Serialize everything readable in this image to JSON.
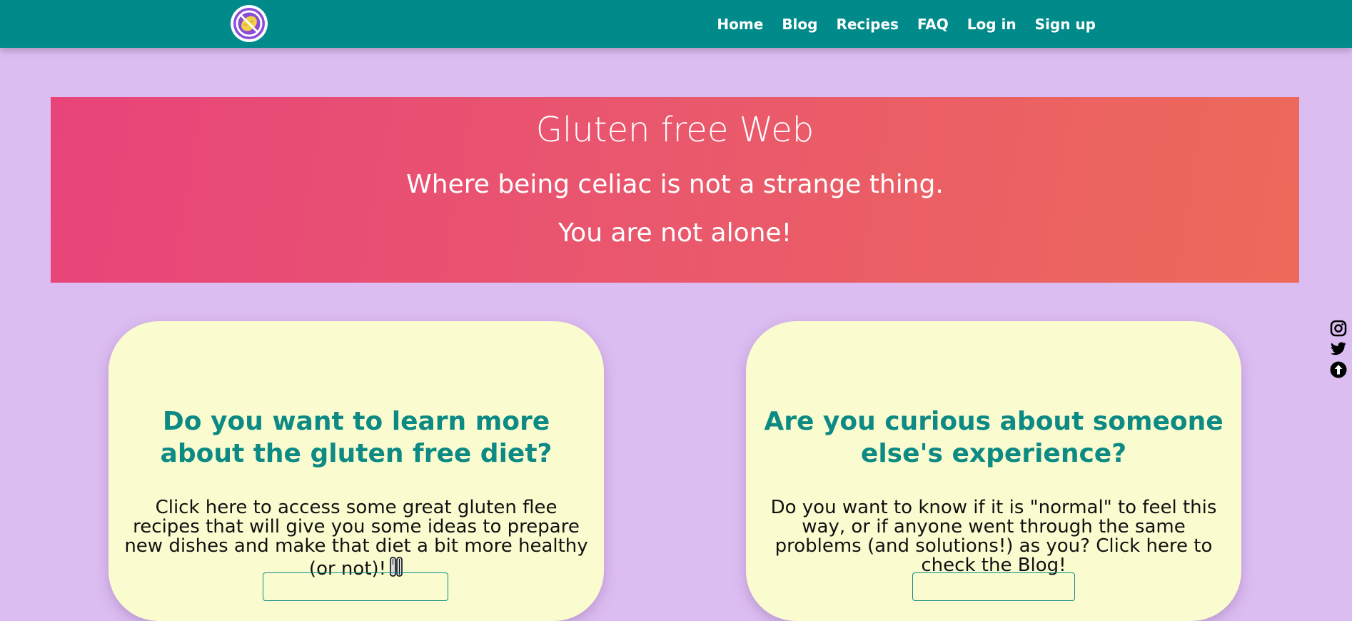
{
  "nav": {
    "logo": "no-gluten-logo-icon",
    "links": [
      "Home",
      "Blog",
      "Recipes",
      "FAQ",
      "Log in",
      "Sign up"
    ]
  },
  "hero": {
    "title": "Gluten free Web",
    "subtitle": "Where being celiac is not a strange thing.",
    "tagline": "You are not alone!"
  },
  "cards": [
    {
      "title": "Do you want to learn more about the gluten free diet?",
      "text": "Click here to access some great gluten flee recipes that will give you some ideas to prepare new dishes and make that diet a bit more healthy (or not)!",
      "icon": "fork-knife-icon"
    },
    {
      "title": "Are you curious about someone else's experience?",
      "text": "Do you want to know if it is \"normal\" to feel this way, or if anyone went through the same problems (and solutions!) as you? Click here to check the Blog!"
    }
  ],
  "social": [
    "instagram-icon",
    "twitter-icon",
    "arrow-up-icon"
  ],
  "colors": {
    "background": "#dcbdf2",
    "navbar": "#008a8a",
    "hero_start": "#e8447a",
    "hero_end": "#ed6a5a",
    "card": "#fafcd0",
    "card_title": "#0d8a84"
  }
}
